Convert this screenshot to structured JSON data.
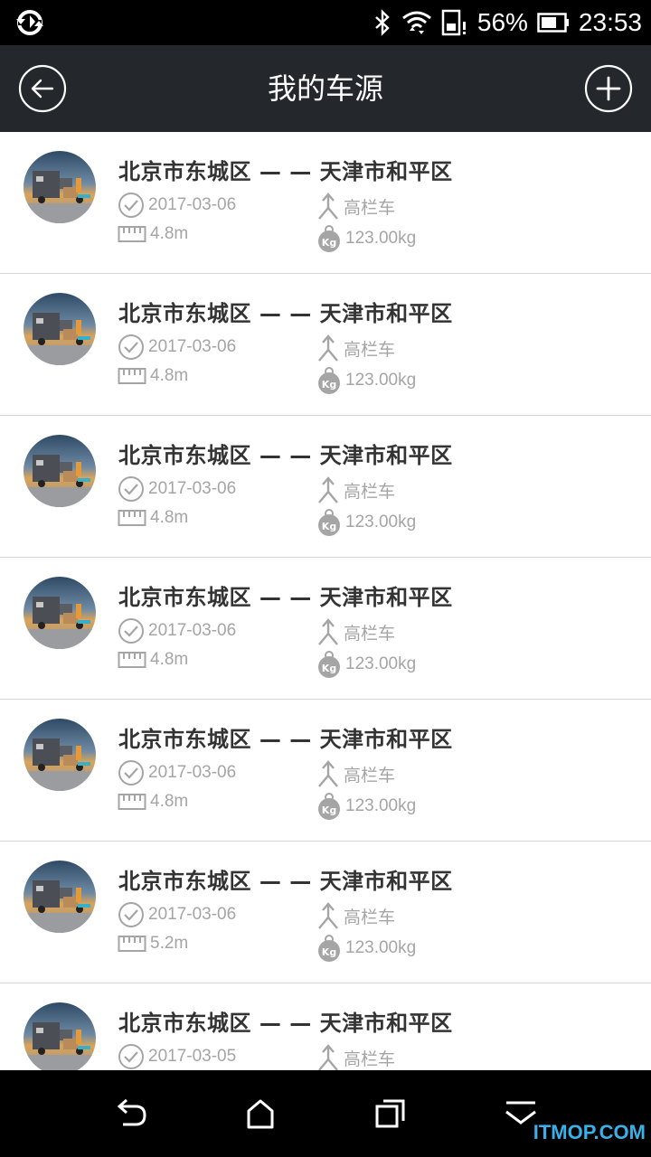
{
  "status_bar": {
    "battery_percent": "56%",
    "time": "23:53"
  },
  "header": {
    "title": "我的车源"
  },
  "list": [
    {
      "route": "北京市东城区 — — 天津市和平区",
      "date": "2017-03-06",
      "truck_type": "高栏车",
      "length": "4.8m",
      "weight": "123.00kg"
    },
    {
      "route": "北京市东城区 — — 天津市和平区",
      "date": "2017-03-06",
      "truck_type": "高栏车",
      "length": "4.8m",
      "weight": "123.00kg"
    },
    {
      "route": "北京市东城区 — — 天津市和平区",
      "date": "2017-03-06",
      "truck_type": "高栏车",
      "length": "4.8m",
      "weight": "123.00kg"
    },
    {
      "route": "北京市东城区 — — 天津市和平区",
      "date": "2017-03-06",
      "truck_type": "高栏车",
      "length": "4.8m",
      "weight": "123.00kg"
    },
    {
      "route": "北京市东城区 — — 天津市和平区",
      "date": "2017-03-06",
      "truck_type": "高栏车",
      "length": "4.8m",
      "weight": "123.00kg"
    },
    {
      "route": "北京市东城区 — — 天津市和平区",
      "date": "2017-03-06",
      "truck_type": "高栏车",
      "length": "5.2m",
      "weight": "123.00kg"
    },
    {
      "route": "北京市东城区 — — 天津市和平区",
      "date": "2017-03-05",
      "truck_type": "高栏车",
      "length": "",
      "weight": ""
    }
  ],
  "watermark": "ITMOP.COM",
  "colors": {
    "header_bg": "#24282c",
    "route_text": "#333333",
    "meta_text": "#a5a5a5",
    "divider": "#d6d6d6"
  },
  "icons": {
    "status": [
      "sync-icon",
      "bluetooth-icon",
      "wifi-icon",
      "sim-icon",
      "battery-icon"
    ],
    "header": [
      "back-icon",
      "plus-icon"
    ],
    "item": [
      "check-circle-icon",
      "ruler-icon",
      "truck-type-icon",
      "kg-weight-icon"
    ],
    "nav": [
      "back-arrow-icon",
      "home-icon",
      "recent-apps-icon",
      "menu-down-icon"
    ]
  }
}
